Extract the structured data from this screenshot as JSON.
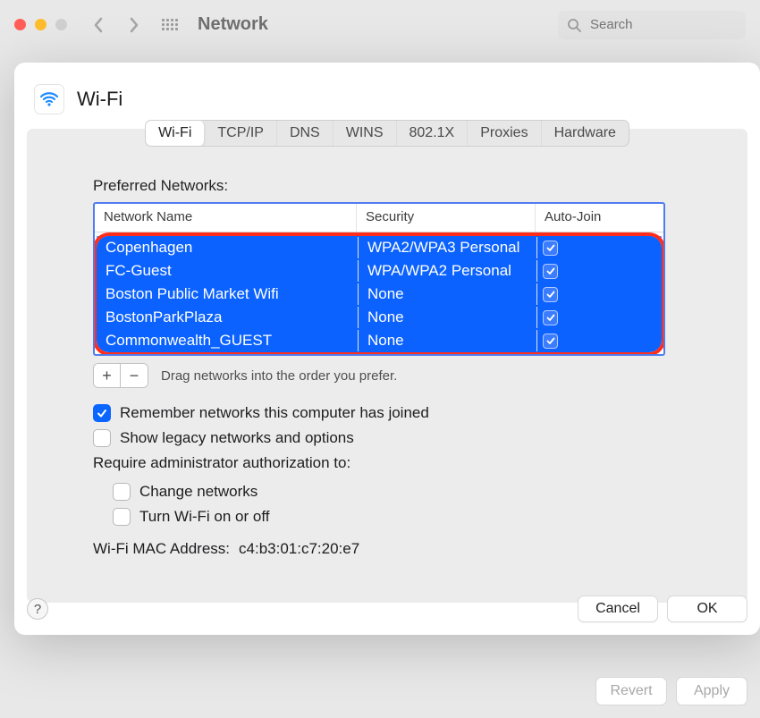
{
  "window": {
    "title": "Network",
    "search_placeholder": "Search"
  },
  "modal": {
    "title": "Wi-Fi",
    "tabs": [
      "Wi-Fi",
      "TCP/IP",
      "DNS",
      "WINS",
      "802.1X",
      "Proxies",
      "Hardware"
    ],
    "active_tab_index": 0,
    "preferred_label": "Preferred Networks:",
    "columns": {
      "name": "Network Name",
      "security": "Security",
      "auto": "Auto-Join"
    },
    "networks": [
      {
        "name": "Copenhagen",
        "security": "WPA2/WPA3 Personal",
        "auto": true
      },
      {
        "name": "FC-Guest",
        "security": "WPA/WPA2 Personal",
        "auto": true
      },
      {
        "name": "Boston Public Market Wifi",
        "security": "None",
        "auto": true
      },
      {
        "name": "BostonParkPlaza",
        "security": "None",
        "auto": true
      },
      {
        "name": "Commonwealth_GUEST",
        "security": "None",
        "auto": true
      }
    ],
    "add_label": "+",
    "remove_label": "−",
    "drag_hint": "Drag networks into the order you prefer.",
    "remember": {
      "checked": true,
      "label": "Remember networks this computer has joined"
    },
    "show_legacy": {
      "checked": false,
      "label": "Show legacy networks and options"
    },
    "admin_label": "Require administrator authorization to:",
    "admin_options": [
      {
        "checked": false,
        "label": "Change networks"
      },
      {
        "checked": false,
        "label": "Turn Wi-Fi on or off"
      }
    ],
    "mac_label": "Wi-Fi MAC Address:",
    "mac_value": "c4:b3:01:c7:20:e7",
    "help_label": "?",
    "cancel_label": "Cancel",
    "ok_label": "OK"
  },
  "window_footer": {
    "revert": "Revert",
    "apply": "Apply"
  }
}
